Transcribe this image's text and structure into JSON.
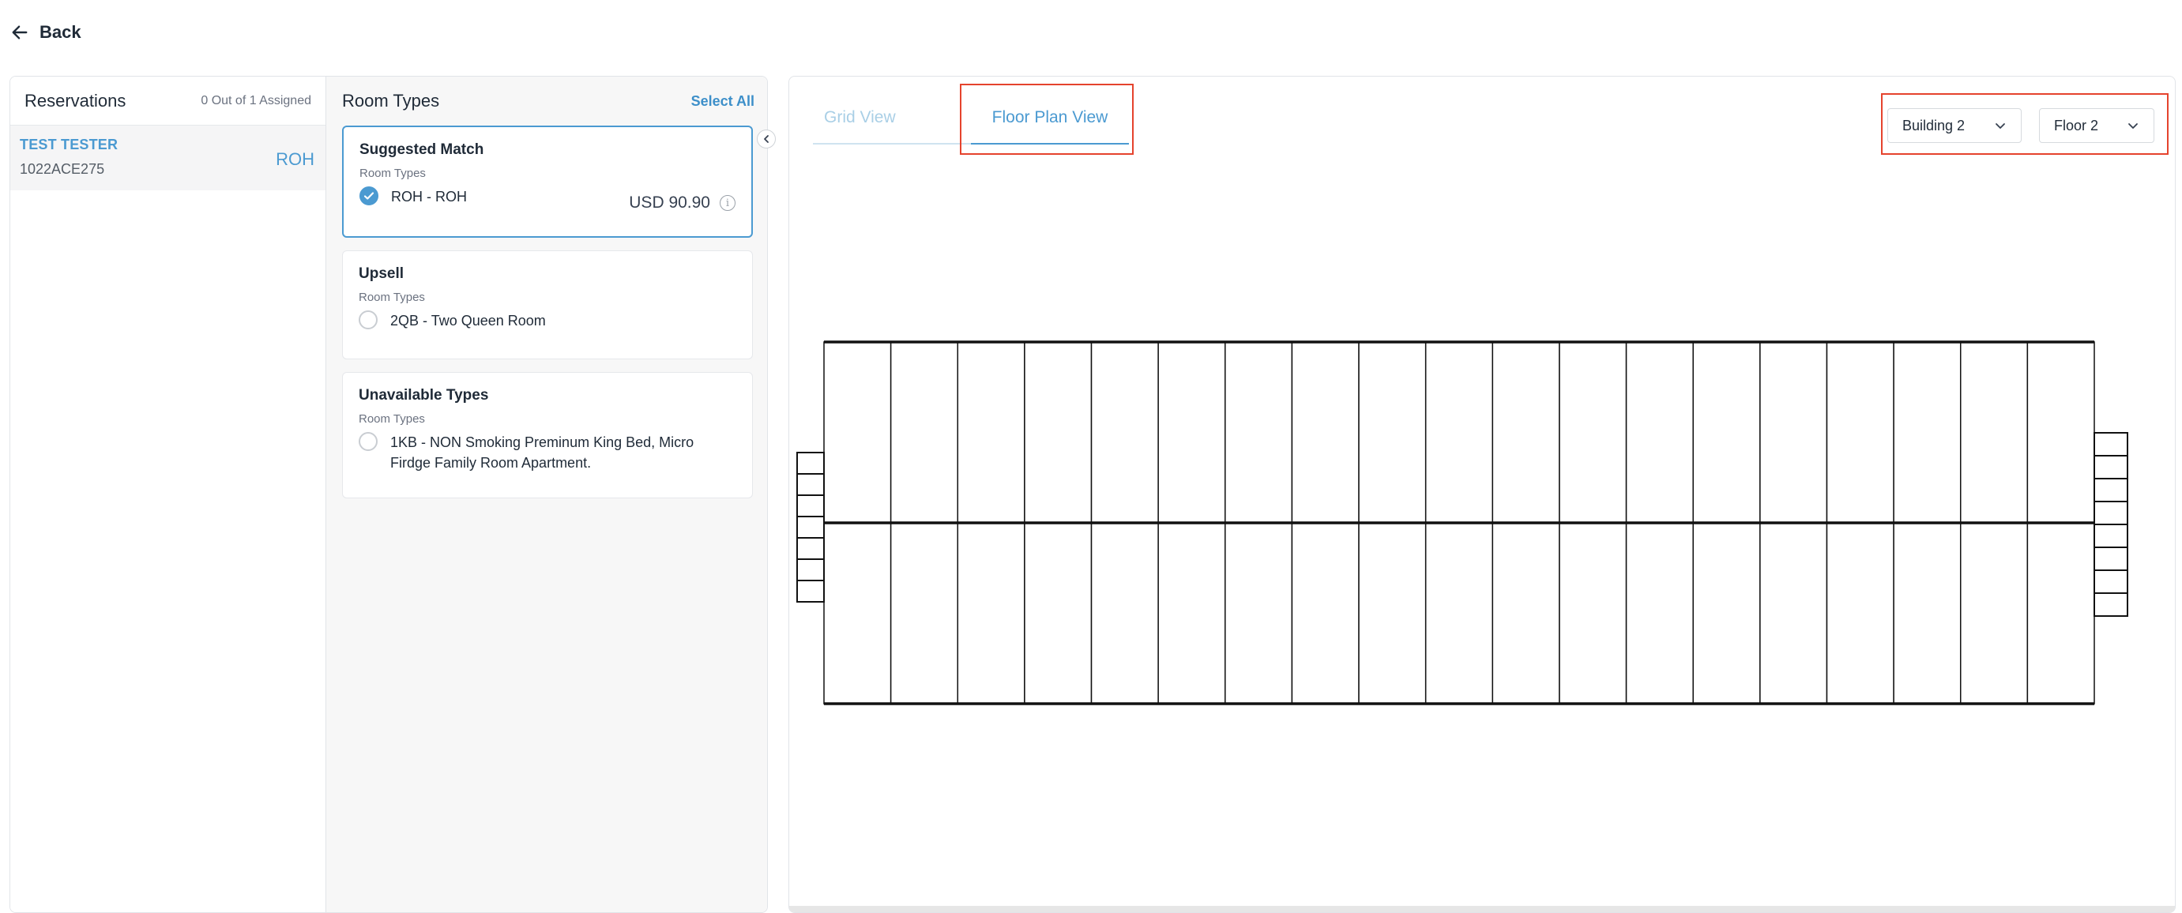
{
  "nav": {
    "back_label": "Back"
  },
  "reservations": {
    "title": "Reservations",
    "count": "0 Out of 1 Assigned",
    "items": [
      {
        "name": "TEST TESTER",
        "id": "1022ACE275",
        "code": "ROH"
      }
    ]
  },
  "room_types": {
    "title": "Room Types",
    "select_all": "Select All",
    "cards": [
      {
        "title": "Suggested Match",
        "sub": "Room Types",
        "option": "ROH - ROH",
        "price": "USD 90.90",
        "selected": true
      },
      {
        "title": "Upsell",
        "sub": "Room Types",
        "option": "2QB - Two Queen Room"
      },
      {
        "title": "Unavailable Types",
        "sub": "Room Types",
        "option": "1KB - NON Smoking Preminum King Bed, Micro Firdge Family Room Apartment."
      }
    ]
  },
  "view": {
    "tabs": [
      {
        "label": "Grid View"
      },
      {
        "label": "Floor Plan View"
      }
    ],
    "active_tab": "Floor Plan View",
    "building": "Building 2",
    "floor": "Floor 2"
  },
  "floor_plan": {
    "rooms_per_row": 19,
    "rows": 2,
    "left_stairs_steps": 7,
    "right_stairs_steps": 8
  },
  "colors": {
    "accent": "#4b9ad1",
    "highlight": "#e5432d"
  }
}
